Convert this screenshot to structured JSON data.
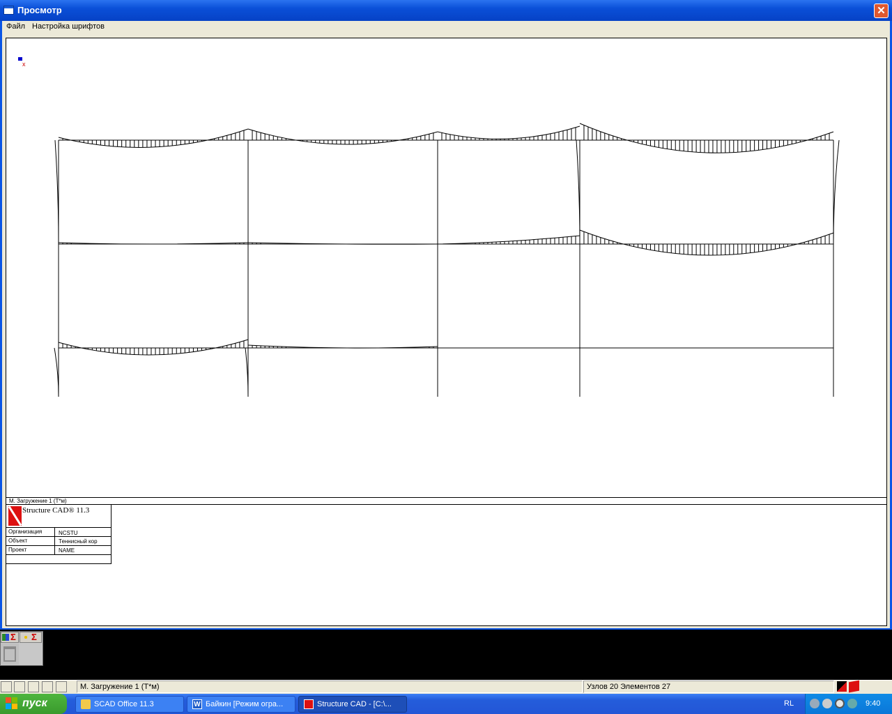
{
  "window": {
    "title": "Просмотр",
    "close_glyph": "✕"
  },
  "menu": {
    "items": [
      "Файл",
      "Настройка шрифтов"
    ]
  },
  "drawing": {
    "axis_label": "x",
    "caption": "М. Загружение 1   (Т*м)"
  },
  "stamp": {
    "product": "Structure CAD® 11.3",
    "rows": [
      {
        "label": "Организация",
        "value": "NCSTU"
      },
      {
        "label": "Объект",
        "value": "Теннисный кор"
      },
      {
        "label": "Проект",
        "value": "NAME"
      }
    ]
  },
  "toolpanel": {
    "sigma_glyph": "Σ"
  },
  "statusbar": {
    "load_case": "М. Загружение 1    (Т*м)",
    "counts": "Узлов 20 Элементов 27"
  },
  "taskbar": {
    "start_label": "пуск",
    "tasks": [
      {
        "label": "SCAD Office 11.3",
        "icon": "folder-icon"
      },
      {
        "label": "Байкин [Режим огра...",
        "icon": "word-icon"
      },
      {
        "label": "Structure CAD  - [C:\\...",
        "icon": "scad-icon"
      }
    ],
    "lang": "RL",
    "clock": "9:40"
  },
  "colors": {
    "titlebar": "#0a55e6",
    "taskbar": "#245ddb",
    "start": "#3a9a2d",
    "logo": "#dd1111"
  }
}
